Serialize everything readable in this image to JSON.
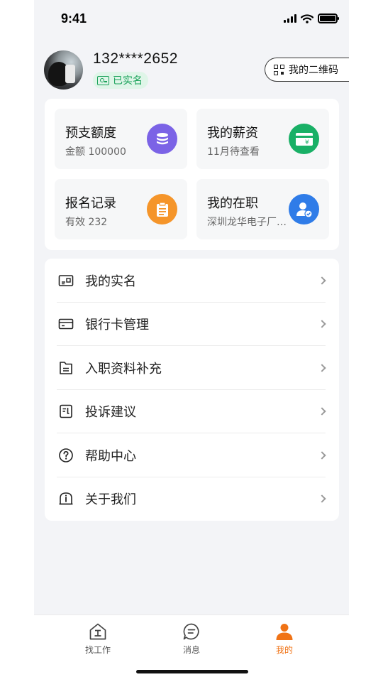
{
  "status_bar": {
    "time": "9:41"
  },
  "profile": {
    "phone": "132****2652",
    "verified_label": "已实名",
    "qr_button_label": "我的二维码"
  },
  "quick_tiles": [
    {
      "title": "预支额度",
      "sub": "金额  100000",
      "icon": "coins-icon",
      "color": "#7b63e6"
    },
    {
      "title": "我的薪资",
      "sub": "11月待查看",
      "icon": "card-yuan-icon",
      "color": "#19b066"
    },
    {
      "title": "报名记录",
      "sub": "有效  232",
      "icon": "clipboard-icon",
      "color": "#f5952a"
    },
    {
      "title": "我的在职",
      "sub": "深圳龙华电子厂科技有限公司",
      "icon": "user-verified-icon",
      "color": "#2f7ce8"
    }
  ],
  "menu": [
    {
      "label": "我的实名",
      "icon": "id-card-icon"
    },
    {
      "label": "银行卡管理",
      "icon": "bank-card-icon"
    },
    {
      "label": "入职资料补充",
      "icon": "document-icon"
    },
    {
      "label": "投诉建议",
      "icon": "feedback-icon"
    },
    {
      "label": "帮助中心",
      "icon": "help-icon"
    },
    {
      "label": "关于我们",
      "icon": "about-icon"
    }
  ],
  "tabs": [
    {
      "label": "找工作",
      "icon": "home-icon",
      "active": false
    },
    {
      "label": "消息",
      "icon": "message-icon",
      "active": false
    },
    {
      "label": "我的",
      "icon": "person-icon",
      "active": true
    }
  ],
  "colors": {
    "accent": "#f07316",
    "verified": "#1aa25a"
  }
}
